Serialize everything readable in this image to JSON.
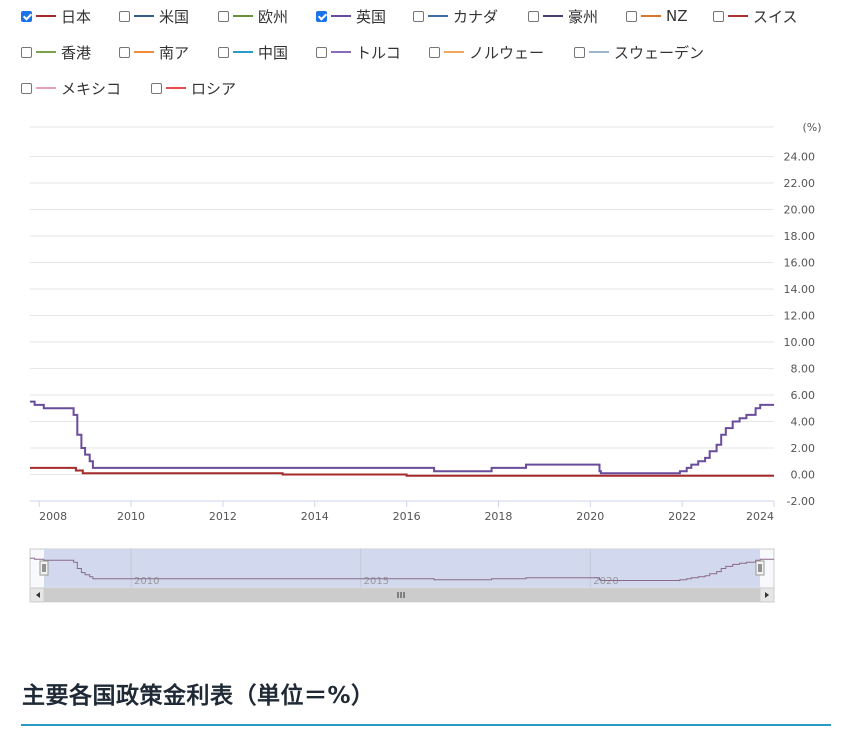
{
  "legend": {
    "items": [
      {
        "label": "日本",
        "color": "#a52a2a",
        "checked": true
      },
      {
        "label": "米国",
        "color": "#2f5f8a",
        "checked": false
      },
      {
        "label": "欧州",
        "color": "#6a8f3a",
        "checked": false
      },
      {
        "label": "英国",
        "color": "#6a4c9c",
        "checked": true
      },
      {
        "label": "カナダ",
        "color": "#3a6ea5",
        "checked": false
      },
      {
        "label": "豪州",
        "color": "#4b3f72",
        "checked": false
      },
      {
        "label": "NZ",
        "color": "#d9782d",
        "checked": false
      },
      {
        "label": "スイス",
        "color": "#a83232",
        "checked": false
      },
      {
        "label": "香港",
        "color": "#7aa34a",
        "checked": false
      },
      {
        "label": "南ア",
        "color": "#f08a3c",
        "checked": false
      },
      {
        "label": "中国",
        "color": "#2a9bc7",
        "checked": false
      },
      {
        "label": "トルコ",
        "color": "#8a6bb8",
        "checked": false
      },
      {
        "label": "ノルウェー",
        "color": "#f0a860",
        "checked": false
      },
      {
        "label": "スウェーデン",
        "color": "#9fb5c9",
        "checked": false
      },
      {
        "label": "メキシコ",
        "color": "#e8a0b8",
        "checked": false
      },
      {
        "label": "ロシア",
        "color": "#e05050",
        "checked": false
      }
    ]
  },
  "chart_data": {
    "type": "line",
    "unit_label": "(%)",
    "ylim": [
      -2,
      26
    ],
    "yticks": [
      "24.00",
      "22.00",
      "20.00",
      "18.00",
      "16.00",
      "14.00",
      "12.00",
      "10.00",
      "8.00",
      "6.00",
      "4.00",
      "2.00",
      "0.00",
      "-2.00"
    ],
    "xlim": [
      2007.8,
      2024.0
    ],
    "xticks": [
      "2008",
      "2010",
      "2012",
      "2014",
      "2016",
      "2018",
      "2020",
      "2022",
      "2024"
    ],
    "grid": true,
    "series": [
      {
        "name": "英国",
        "color": "#6a4c9c",
        "points": [
          [
            2007.8,
            5.5
          ],
          [
            2007.9,
            5.25
          ],
          [
            2008.1,
            5.0
          ],
          [
            2008.75,
            4.5
          ],
          [
            2008.83,
            3.0
          ],
          [
            2008.92,
            2.0
          ],
          [
            2009.0,
            1.5
          ],
          [
            2009.1,
            1.0
          ],
          [
            2009.17,
            0.5
          ],
          [
            2016.6,
            0.25
          ],
          [
            2017.85,
            0.5
          ],
          [
            2018.6,
            0.75
          ],
          [
            2020.2,
            0.25
          ],
          [
            2020.23,
            0.1
          ],
          [
            2021.95,
            0.25
          ],
          [
            2022.1,
            0.5
          ],
          [
            2022.2,
            0.75
          ],
          [
            2022.35,
            1.0
          ],
          [
            2022.5,
            1.25
          ],
          [
            2022.6,
            1.75
          ],
          [
            2022.75,
            2.25
          ],
          [
            2022.85,
            3.0
          ],
          [
            2022.95,
            3.5
          ],
          [
            2023.1,
            4.0
          ],
          [
            2023.25,
            4.25
          ],
          [
            2023.4,
            4.5
          ],
          [
            2023.6,
            5.0
          ],
          [
            2023.7,
            5.25
          ],
          [
            2024.0,
            5.25
          ]
        ]
      },
      {
        "name": "日本",
        "color": "#a52a2a",
        "points": [
          [
            2007.8,
            0.5
          ],
          [
            2008.8,
            0.3
          ],
          [
            2008.95,
            0.1
          ],
          [
            2013.3,
            0.0
          ],
          [
            2016.0,
            -0.1
          ],
          [
            2024.0,
            -0.1
          ]
        ]
      }
    ],
    "navigator": {
      "xticks": [
        "2010",
        "2015",
        "2020"
      ],
      "xlim": [
        2007.8,
        2024.0
      ]
    }
  },
  "section": {
    "heading": "主要各国政策金利表（単位＝%）"
  }
}
